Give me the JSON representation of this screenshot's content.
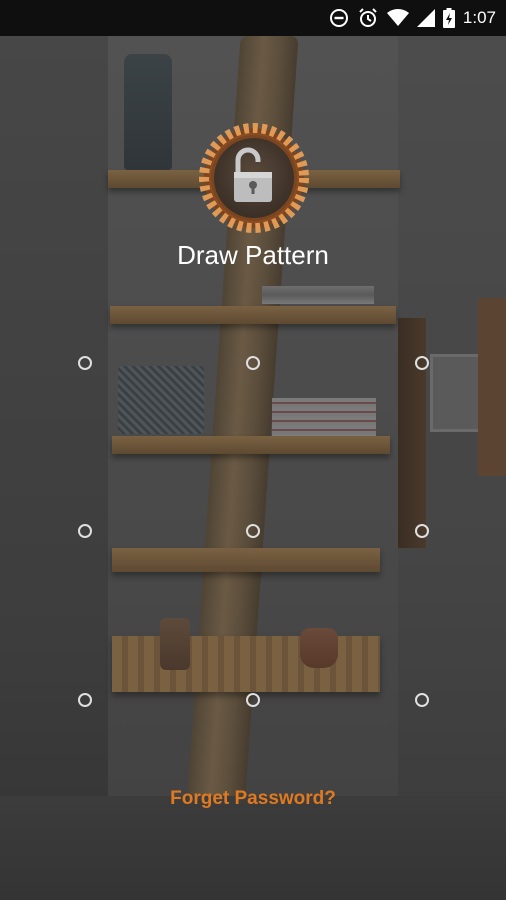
{
  "status_bar": {
    "time": "1:07",
    "icons": [
      "do-not-disturb-icon",
      "alarm-icon",
      "wifi-icon",
      "cellular-signal-icon",
      "battery-charging-icon"
    ]
  },
  "lock_screen": {
    "badge_icon": "unlocked-padlock-icon",
    "title": "Draw Pattern",
    "pattern_dots": [
      {
        "row": 1,
        "col": 1
      },
      {
        "row": 1,
        "col": 2
      },
      {
        "row": 1,
        "col": 3
      },
      {
        "row": 2,
        "col": 1
      },
      {
        "row": 2,
        "col": 2
      },
      {
        "row": 2,
        "col": 3
      },
      {
        "row": 3,
        "col": 1
      },
      {
        "row": 3,
        "col": 2
      },
      {
        "row": 3,
        "col": 3
      }
    ],
    "forget_password": "Forget Password?"
  },
  "colors": {
    "accent": "#e07a20",
    "badge_ring": "#c8702a",
    "dot": "#e0e0e0"
  }
}
